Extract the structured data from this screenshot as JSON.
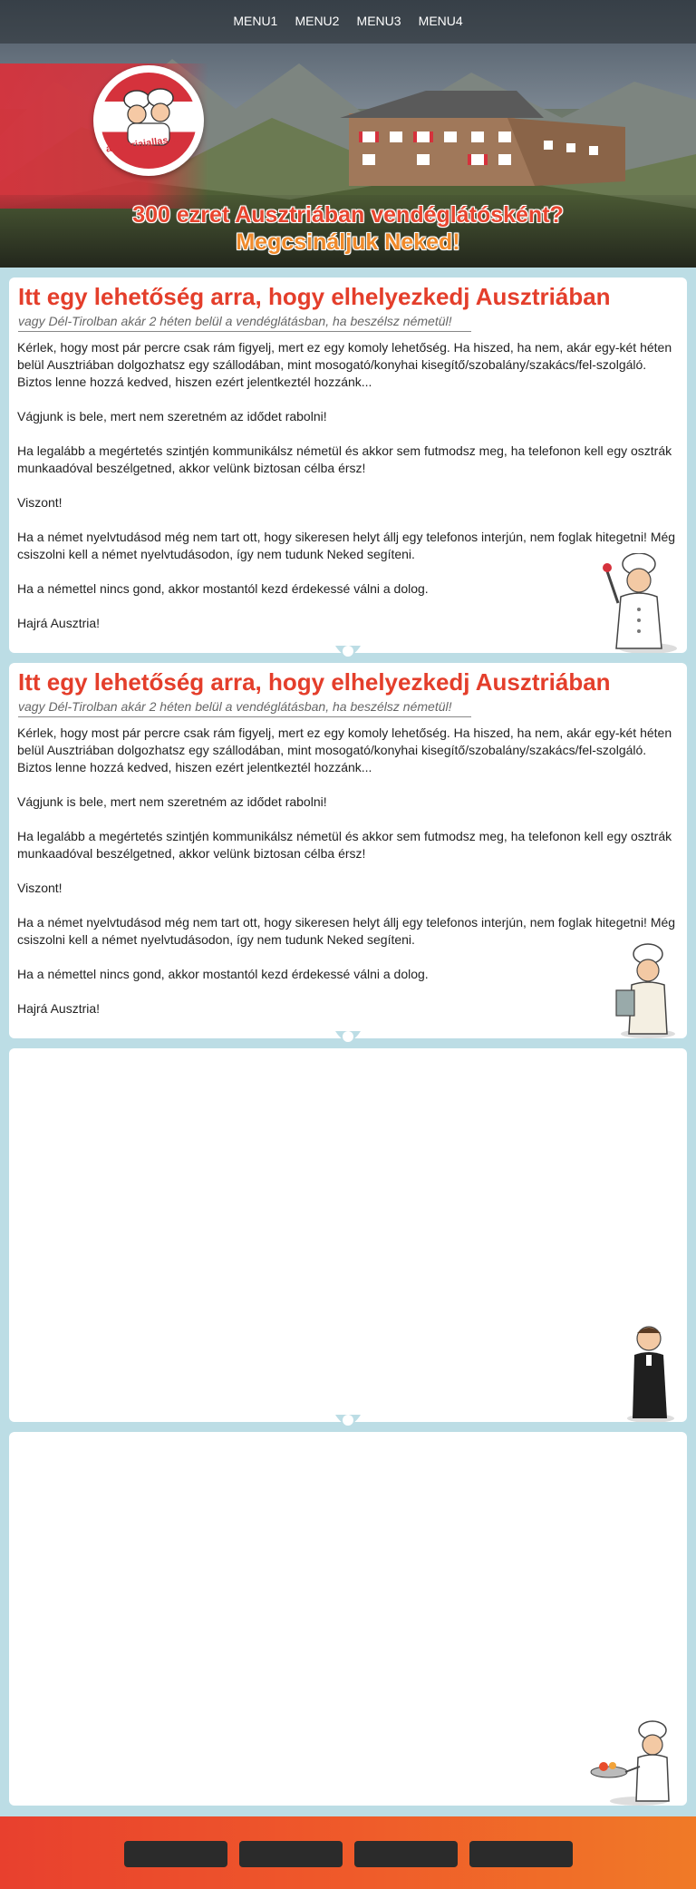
{
  "nav": {
    "items": [
      "MENU1",
      "MENU2",
      "MENU3",
      "MENU4"
    ]
  },
  "logo": {
    "text": "ausztriaiallas.com"
  },
  "hero": {
    "headline_line1": "300 ezret Ausztriában vendéglátósként?",
    "headline_line2": "Megcsináljuk Neked!"
  },
  "cards": [
    {
      "title": "Itt egy lehetőség arra, hogy elhelyezkedj Ausztriában",
      "subtitle": "vagy Dél-Tirolban akár 2 héten belül a vendéglátásban, ha beszélsz németül!",
      "paragraphs": [
        "Kérlek, hogy most pár percre csak rám figyelj, mert ez egy komoly lehetőség. Ha hiszed, ha nem, akár egy-két héten belül Ausztriában dolgozhatsz egy szállodában, mint mosogató/konyhai kisegítő/szobalány/szakács/fel-szolgáló. Biztos lenne hozzá kedved, hiszen ezért jelentkeztél hozzánk...",
        "Vágjunk is bele, mert nem szeretném az idődet rabolni!",
        "Ha legalább a megértetés szintjén kommunikálsz németül és akkor sem futmodsz meg, ha telefonon kell egy osztrák munkaadóval beszélgetned, akkor velünk biztosan célba érsz!",
        "Viszont!",
        "Ha a német nyelvtudásod még nem tart ott, hogy sikeresen helyt állj egy telefonos interjún, nem foglak hitegetni! Még csiszolni kell a német nyelvtudásodon, így nem tudunk Neked segíteni.",
        "Ha a némettel nincs gond, akkor mostantól kezd érdekessé válni a dolog.",
        "Hajrá Ausztria!"
      ]
    },
    {
      "title": "Itt egy lehetőség arra, hogy elhelyezkedj Ausztriában",
      "subtitle": "vagy Dél-Tirolban akár 2 héten belül a vendéglátásban, ha beszélsz németül!",
      "paragraphs": [
        "Kérlek, hogy most pár percre csak rám figyelj, mert ez egy komoly lehetőség. Ha hiszed, ha nem, akár egy-két héten belül Ausztriában dolgozhatsz egy szállodában, mint mosogató/konyhai kisegítő/szobalány/szakács/fel-szolgáló. Biztos lenne hozzá kedved, hiszen ezért jelentkeztél hozzánk...",
        "Vágjunk is bele, mert nem szeretném az idődet rabolni!",
        "Ha legalább a megértetés szintjén kommunikálsz németül és akkor sem futmodsz meg, ha telefonon kell egy osztrák munkaadóval beszélgetned, akkor velünk biztosan célba érsz!",
        "Viszont!",
        "Ha a német nyelvtudásod még nem tart ott, hogy sikeresen helyt állj egy telefonos interjún, nem foglak hitegetni! Még csiszolni kell a német nyelvtudásodon, így nem tudunk Neked segíteni.",
        "Ha a némettel nincs gond, akkor mostantól kezd érdekessé válni a dolog.",
        "Hajrá Ausztria!"
      ]
    }
  ],
  "colors": {
    "accent_red": "#e43e2b",
    "accent_orange": "#f07a27",
    "page_background": "#bcdde5",
    "footer_button": "#2b2b2b"
  }
}
